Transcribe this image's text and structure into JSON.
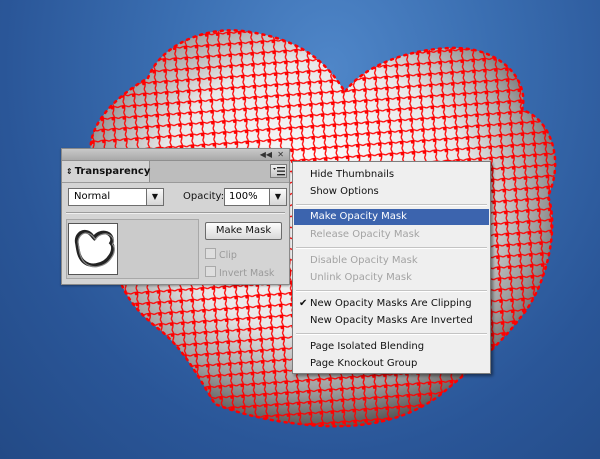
{
  "panel": {
    "tab_label": "Transparency",
    "blend_mode": "Normal",
    "opacity_label": "Opacity:",
    "opacity_value": "100%",
    "make_mask_label": "Make Mask",
    "clip_label": "Clip",
    "invert_mask_label": "Invert Mask",
    "icons": [
      "collapse-icon",
      "close-icon",
      "tab-arrows-icon",
      "panel-menu-icon",
      "dropdown-arrow-icon"
    ]
  },
  "menu": {
    "items": [
      {
        "label": "Hide Thumbnails",
        "enabled": true
      },
      {
        "label": "Show Options",
        "enabled": true
      },
      {
        "label": "Make Opacity Mask",
        "enabled": true,
        "highlighted": true
      },
      {
        "label": "Release Opacity Mask",
        "enabled": false
      },
      {
        "label": "Disable Opacity Mask",
        "enabled": false
      },
      {
        "label": "Unlink Opacity Mask",
        "enabled": false
      },
      {
        "label": "New Opacity Masks Are Clipping",
        "enabled": true,
        "checked": true
      },
      {
        "label": "New Opacity Masks Are Inverted",
        "enabled": true
      },
      {
        "label": "Page Isolated Blending",
        "enabled": true
      },
      {
        "label": "Page Knockout Group",
        "enabled": true
      }
    ]
  },
  "colors": {
    "mesh_red": "#ff0000",
    "menu_highlight": "#3c64ae",
    "background_blue": "#3a6eb1"
  }
}
